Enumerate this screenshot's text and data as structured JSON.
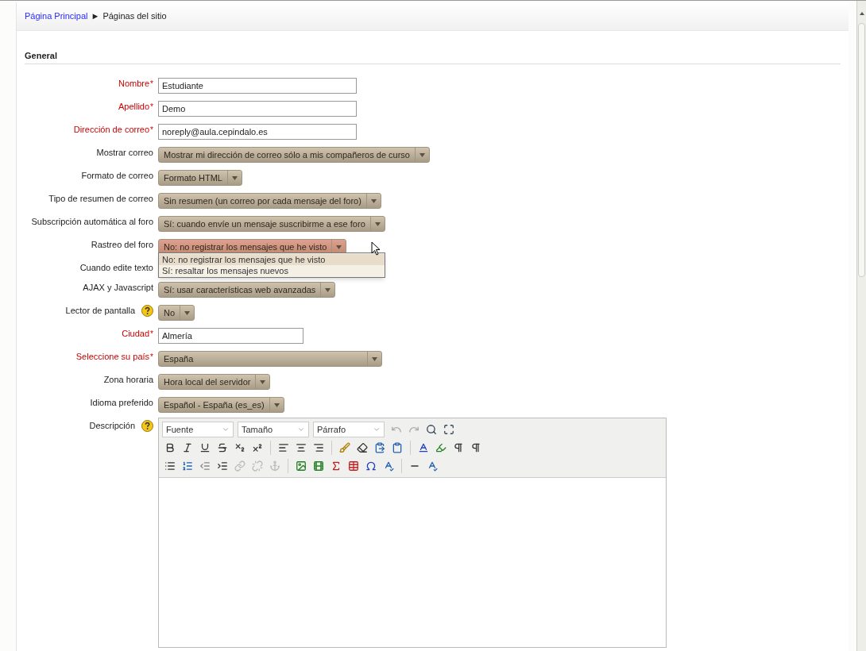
{
  "breadcrumb": [
    {
      "label": "Página Principal",
      "kind": "link"
    },
    {
      "label": "►",
      "kind": "separator"
    },
    {
      "label": "Páginas del sitio",
      "kind": "text"
    }
  ],
  "section": {
    "title": "General"
  },
  "required_marker": "*",
  "fields": [
    {
      "label": "Nombre",
      "required": true,
      "kind": "text",
      "value": "Estudiante"
    },
    {
      "label": "Apellido",
      "required": true,
      "kind": "text",
      "value": "Demo"
    },
    {
      "label": "Dirección de correo",
      "required": true,
      "kind": "text",
      "value": "noreply@aula.cepindalo.es"
    },
    {
      "label": "Mostrar correo",
      "required": false,
      "kind": "select",
      "value": "Mostrar mi dirección de correo sólo a mis compañeros de curso"
    },
    {
      "label": "Formato de correo",
      "required": false,
      "kind": "select",
      "value": "Formato HTML"
    },
    {
      "label": "Tipo de resumen de correo",
      "required": false,
      "kind": "select",
      "value": "Sin resumen (un correo por cada mensaje del foro)"
    },
    {
      "label": "Subscripción automática al foro",
      "required": false,
      "kind": "select",
      "value": "Sí: cuando envíe un mensaje suscribirme a ese foro"
    },
    {
      "label": "Rastreo del foro",
      "required": false,
      "kind": "select",
      "value": "No: no registrar los mensajes que he visto",
      "focused": true,
      "options": [
        {
          "label": "No: no registrar los mensajes que he visto",
          "selected": true
        },
        {
          "label": "Sí: resaltar los mensajes nuevos",
          "selected": false
        }
      ]
    },
    {
      "label": "Cuando edite texto",
      "required": false,
      "kind": "select"
    },
    {
      "label": "AJAX y Javascript",
      "required": false,
      "kind": "select",
      "value": "Sí: usar características web avanzadas"
    },
    {
      "label": "Lector de pantalla",
      "required": false,
      "kind": "select",
      "value": "No",
      "help": true
    },
    {
      "label": "Ciudad",
      "required": true,
      "kind": "text",
      "value": "Almería"
    },
    {
      "label": "Seleccione su país",
      "required": true,
      "kind": "select",
      "value": "España"
    },
    {
      "label": "Zona horaria",
      "required": false,
      "kind": "select",
      "value": "Hora local del servidor"
    },
    {
      "label": "Idioma preferido",
      "required": false,
      "kind": "select",
      "value": "Español - España (es_es)"
    },
    {
      "label": "Descripción",
      "required": false,
      "kind": "editor",
      "help": true
    }
  ],
  "editor": {
    "dropdowns": [
      "Fuente",
      "Tamaño",
      "Párrafo"
    ]
  }
}
